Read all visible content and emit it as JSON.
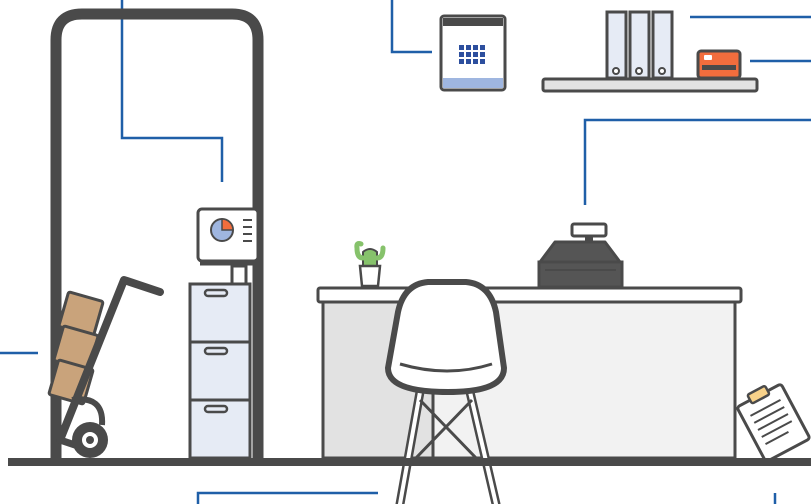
{
  "scene": {
    "type": "office-front-desk-illustration",
    "colors": {
      "background": "#ffffff",
      "outline": "#4a4a4a",
      "callout_line": "#1f5fa8",
      "calendar_accent": "#2d4f9e",
      "calendar_header": "#9fb6e0",
      "cabinet": "#e6ebf5",
      "desk_body": "#e2e2e2",
      "register": "#555555",
      "card": "#f26d3d",
      "box": "#c9a37b",
      "plant": "#86c26b",
      "clipboard": "#f8d28a"
    },
    "items": [
      {
        "name": "door-frame-icon"
      },
      {
        "name": "hand-truck-icon"
      },
      {
        "name": "file-cabinet-icon"
      },
      {
        "name": "monitor-icon"
      },
      {
        "name": "calendar-icon"
      },
      {
        "name": "binders-icon"
      },
      {
        "name": "credit-card-icon"
      },
      {
        "name": "shelf-icon"
      },
      {
        "name": "cash-register-icon"
      },
      {
        "name": "desk-icon"
      },
      {
        "name": "cactus-plant-icon"
      },
      {
        "name": "chair-icon"
      },
      {
        "name": "clipboard-icon"
      }
    ]
  }
}
